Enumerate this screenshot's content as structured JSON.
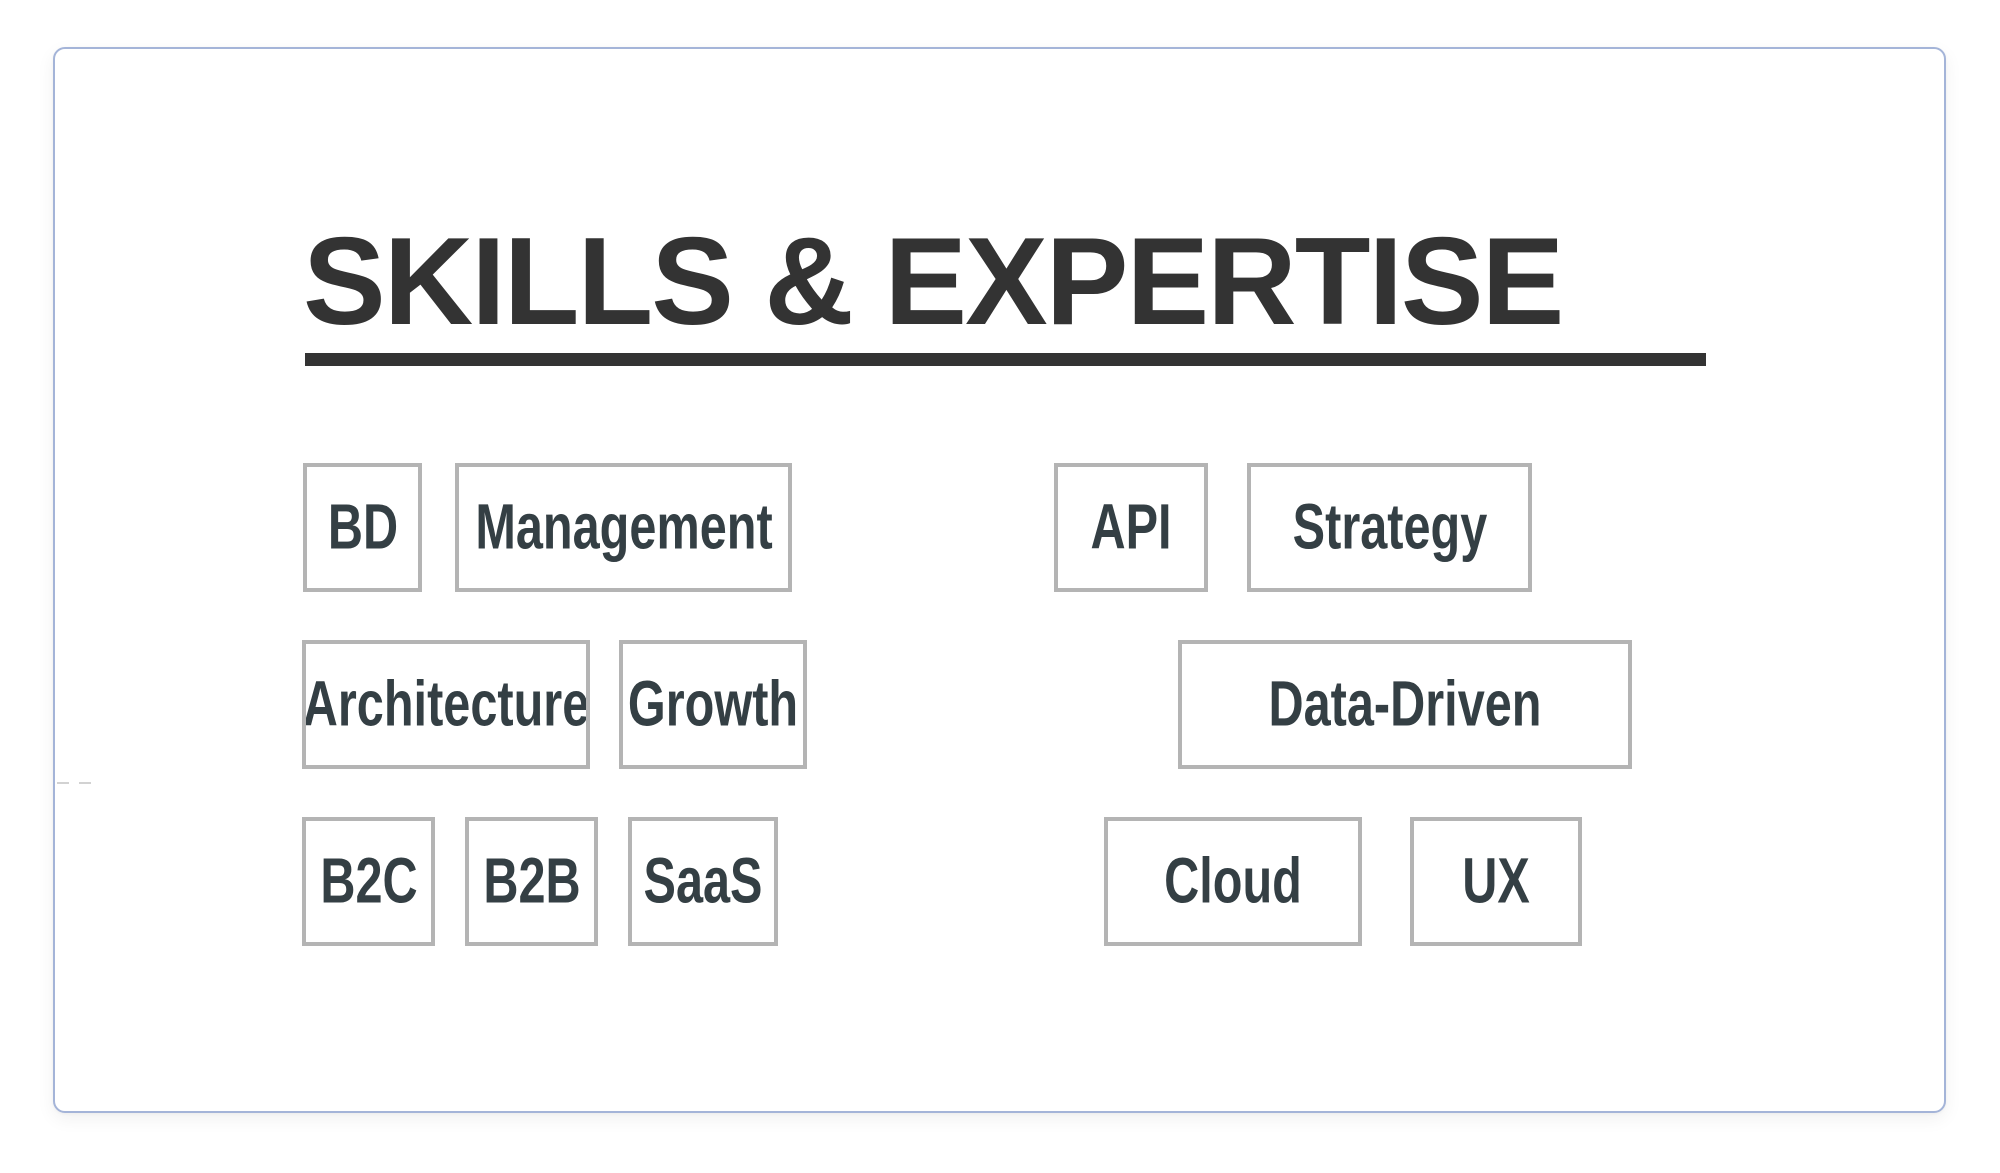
{
  "section": {
    "title": "SKILLS & EXPERTISE"
  },
  "tags": {
    "row1": [
      "BD",
      "Management",
      "API",
      "Strategy"
    ],
    "row2": [
      "Architecture",
      "Growth",
      "Data-Driven"
    ],
    "row3": [
      "B2C",
      "B2B",
      "SaaS",
      "Cloud",
      "UX"
    ]
  },
  "colors": {
    "title_text": "#333333",
    "tag_text": "#343f44",
    "tag_border": "#b4b4b4",
    "card_border": "#a4b4d8",
    "background": "#ffffff"
  }
}
